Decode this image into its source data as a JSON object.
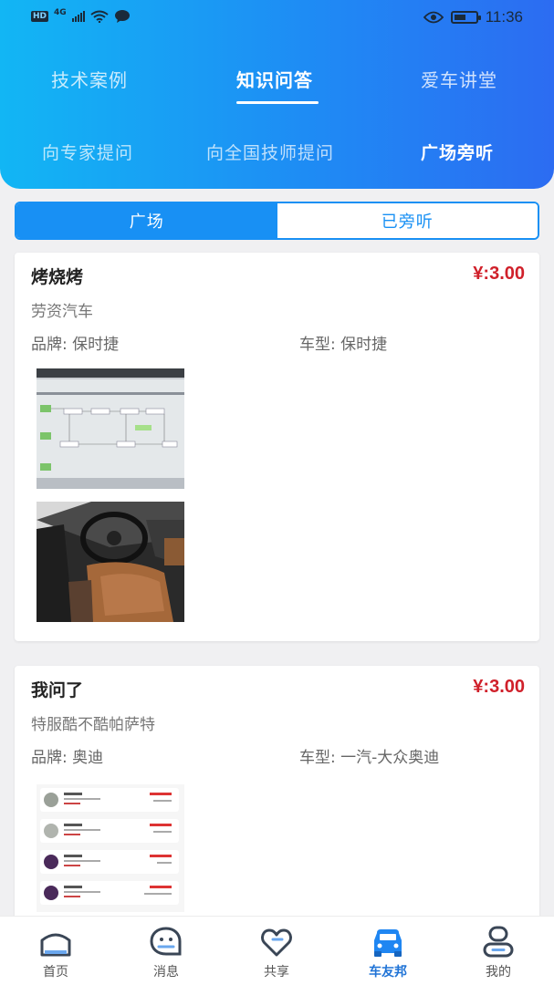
{
  "status_bar": {
    "network_badge": "HD",
    "network_type": "4G",
    "time": "11:36",
    "battery_level": 0.55
  },
  "top_tabs": [
    {
      "label": "技术案例",
      "active": false
    },
    {
      "label": "知识问答",
      "active": true
    },
    {
      "label": "爱车讲堂",
      "active": false
    }
  ],
  "sub_tabs": [
    {
      "label": "向专家提问",
      "active": false
    },
    {
      "label": "向全国技师提问",
      "active": false
    },
    {
      "label": "广场旁听",
      "active": true
    }
  ],
  "segment": {
    "left_label": "广场",
    "right_label": "已旁听",
    "selected": "left"
  },
  "posts": [
    {
      "title": "烤烧烤",
      "price": "¥:3.00",
      "company": "劳资汽车",
      "brand": "品牌: 保时捷",
      "model": "车型: 保时捷",
      "images": [
        "flowchart-photo",
        "car-interior-photo"
      ]
    },
    {
      "title": "我问了",
      "price": "¥:3.00",
      "company": "特服酷不酷帕萨特",
      "brand": "品牌: 奥迪",
      "model": "车型: 一汽-大众奥迪",
      "images": [
        "order-list-screenshot"
      ]
    }
  ],
  "bottom_nav": [
    {
      "label": "首页",
      "icon": "home-icon",
      "active": false
    },
    {
      "label": "消息",
      "icon": "message-icon",
      "active": false
    },
    {
      "label": "共享",
      "icon": "share-heart-icon",
      "active": false
    },
    {
      "label": "车友邦",
      "icon": "car-club-icon",
      "active": true
    },
    {
      "label": "我的",
      "icon": "profile-icon",
      "active": false
    }
  ],
  "colors": {
    "accent": "#1890f4",
    "price": "#d0202a",
    "active_nav": "#1f73d6"
  }
}
